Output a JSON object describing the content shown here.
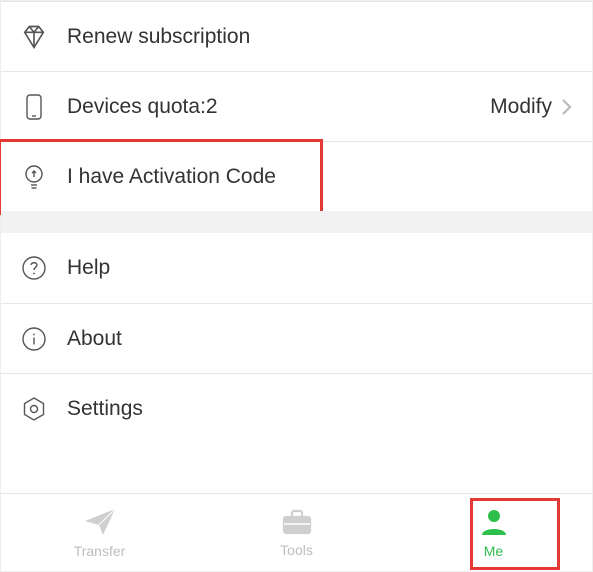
{
  "menu": {
    "renew": {
      "label": "Renew subscription"
    },
    "devices": {
      "label": "Devices quota:2",
      "action": "Modify"
    },
    "activation": {
      "label": "I have Activation Code"
    },
    "help": {
      "label": "Help"
    },
    "about": {
      "label": "About"
    },
    "settings": {
      "label": "Settings"
    }
  },
  "tabs": {
    "transfer": {
      "label": "Transfer"
    },
    "tools": {
      "label": "Tools"
    },
    "me": {
      "label": "Me"
    }
  },
  "colors": {
    "accent": "#2dbf4b",
    "highlight": "#e53935"
  }
}
